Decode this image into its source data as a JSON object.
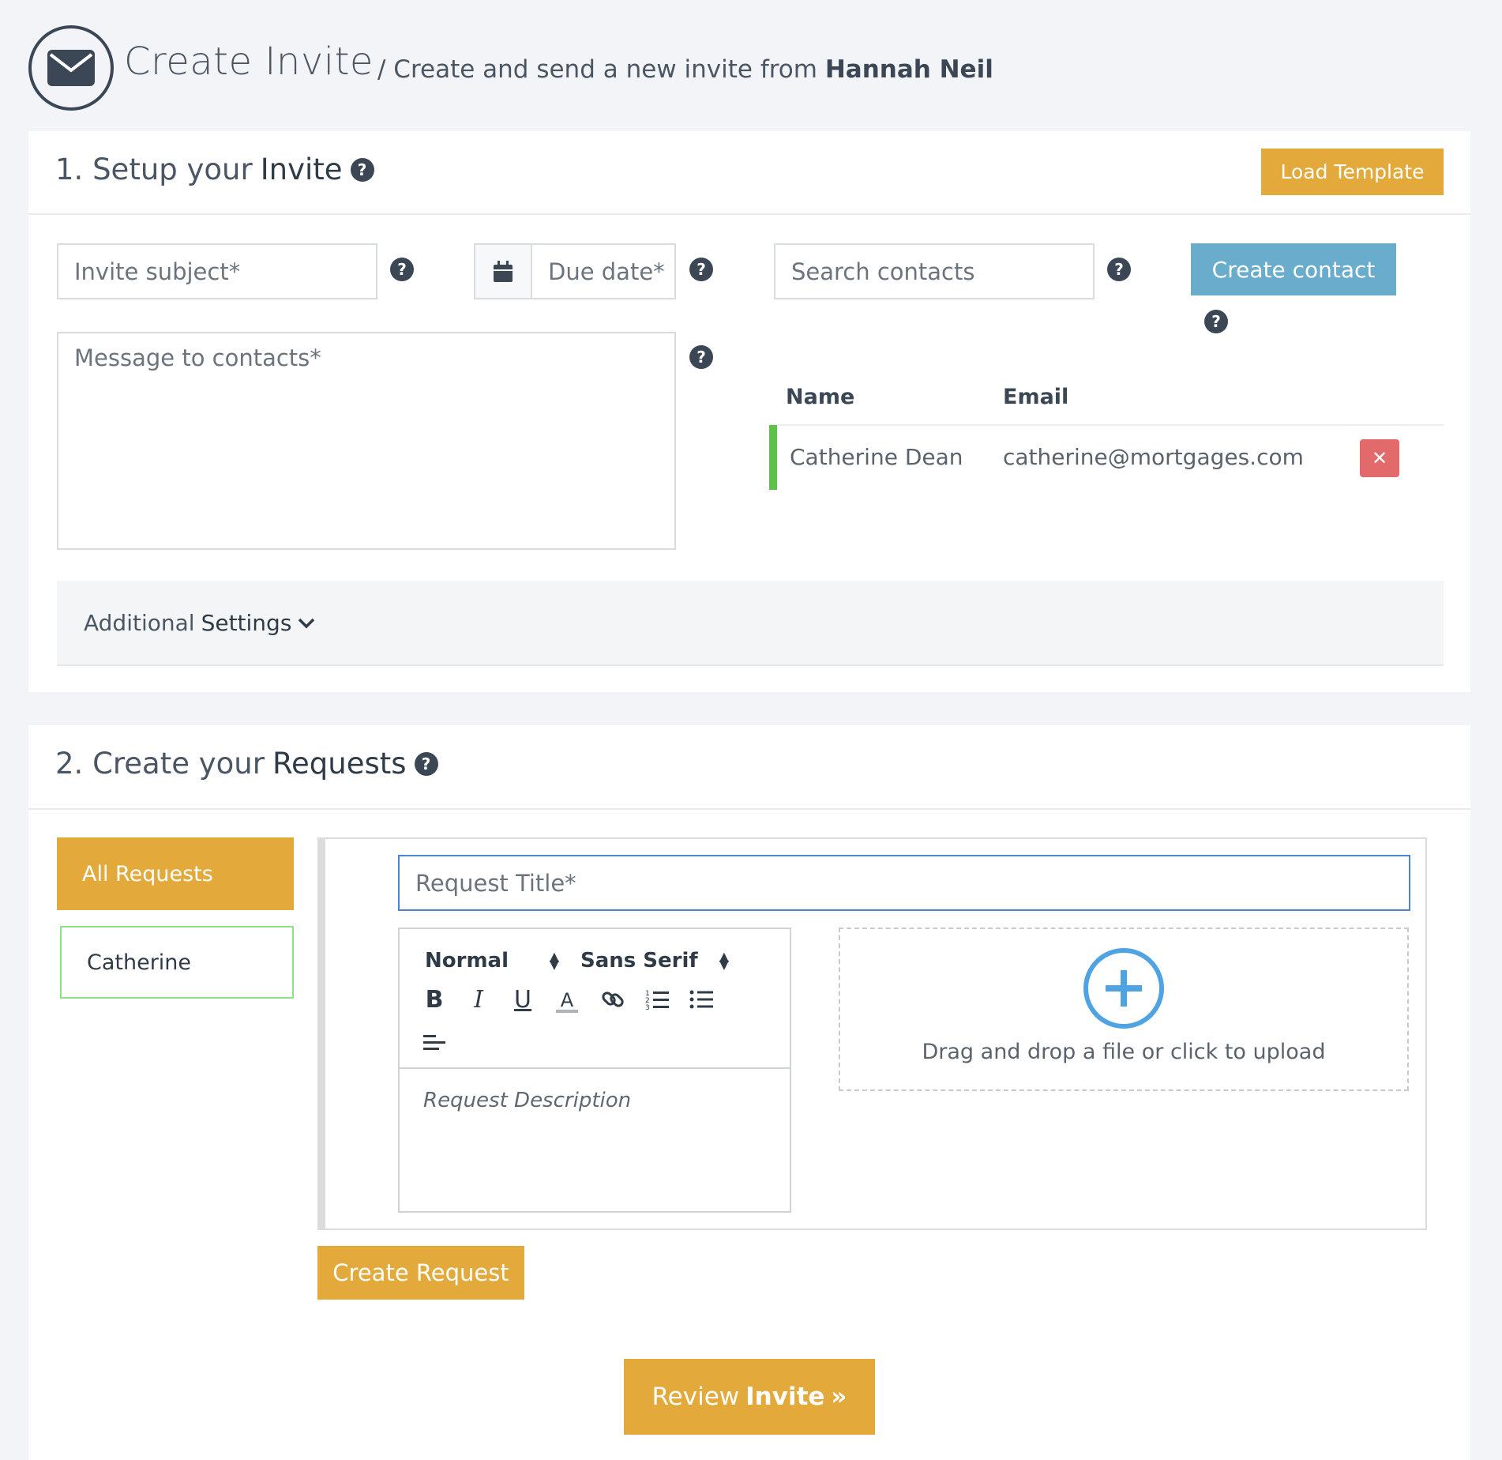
{
  "header": {
    "title": "Create Invite",
    "subtitle_prefix": "/ Create and send a new invite from",
    "sender_name": "Hannah Neil"
  },
  "section1": {
    "title_prefix": "1. Setup your",
    "title_bold": "Invite",
    "load_template_label": "Load Template",
    "invite_subject_placeholder": "Invite subject*",
    "due_date_placeholder": "Due date*",
    "search_contacts_placeholder": "Search contacts",
    "create_contact_label": "Create contact",
    "message_placeholder": "Message to contacts*",
    "contacts_table": {
      "headers": [
        "Name",
        "Email"
      ],
      "rows": [
        {
          "name": "Catherine Dean",
          "email": "catherine@mortgages.com"
        }
      ]
    },
    "additional_settings_prefix": "Additional",
    "additional_settings_bold": "Settings"
  },
  "section2": {
    "title_prefix": "2. Create your",
    "title_bold": "Requests",
    "sidebar": {
      "all_requests_label": "All Requests",
      "contact_label": "Catherine"
    },
    "request_title_placeholder": "Request Title*",
    "editor": {
      "format_select": "Normal",
      "font_select": "Sans Serif",
      "description_placeholder": "Request Description"
    },
    "upload_text": "Drag and drop a file or click to upload",
    "create_request_label": "Create Request"
  },
  "footer": {
    "review_prefix": "Review",
    "review_bold": "Invite"
  },
  "colors": {
    "accent_gold": "#e3a93a",
    "button_blue": "#6aaccb",
    "delete_red": "#e26a6a",
    "active_green": "#5ec24a",
    "upload_blue": "#4fa3e3"
  }
}
